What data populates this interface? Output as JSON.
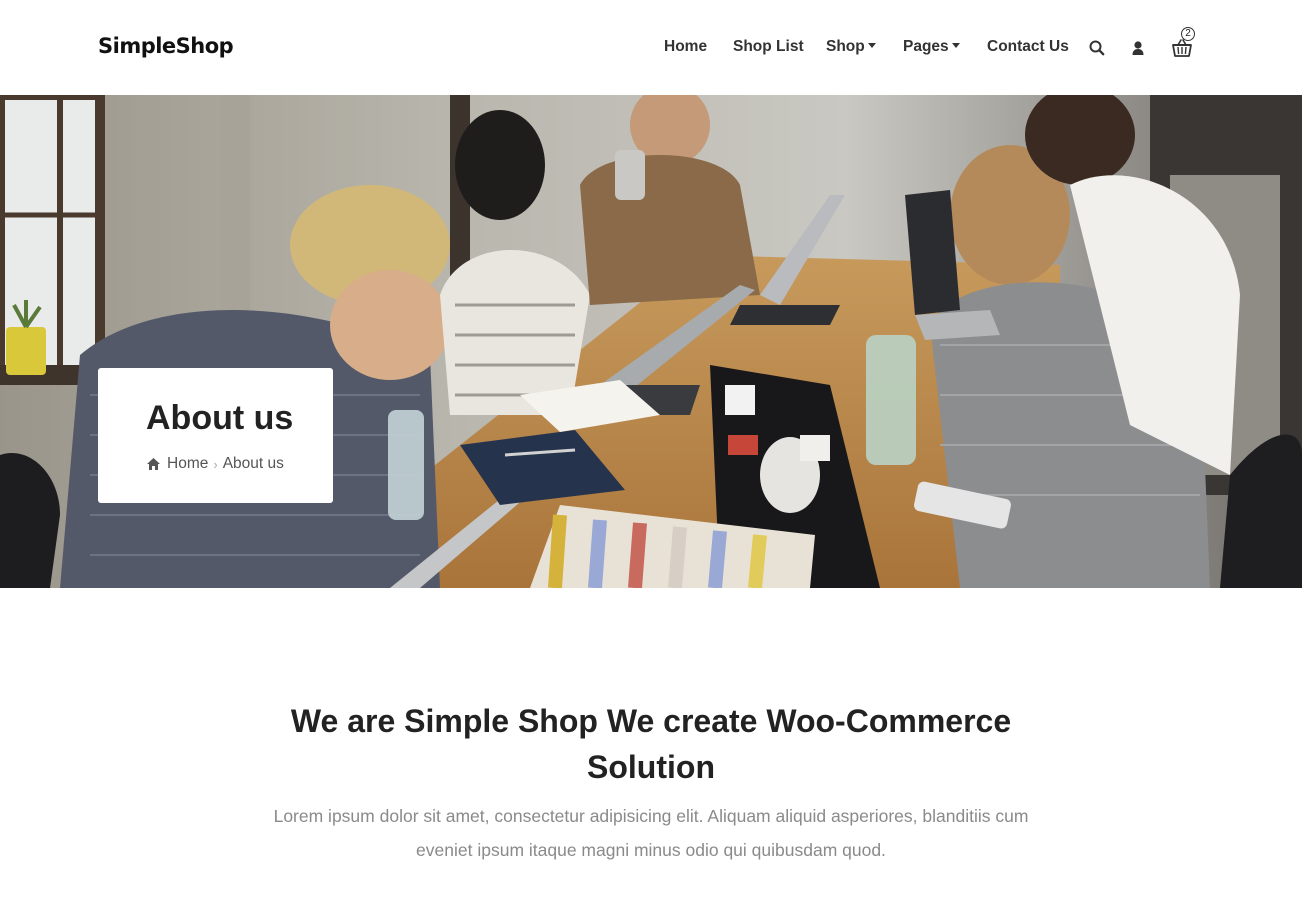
{
  "header": {
    "logo": "SimpleShop",
    "nav": [
      {
        "label": "Home"
      },
      {
        "label": "Shop List"
      },
      {
        "label": "Shop"
      },
      {
        "label": "Pages"
      },
      {
        "label": "Contact Us"
      }
    ],
    "icons": [
      "search-icon",
      "user-icon",
      "cart-icon"
    ],
    "cart_count": "2"
  },
  "hero": {
    "image": "team-working-at-laptops-photo",
    "title": "About us",
    "breadcrumb": {
      "home": "Home",
      "current": "About us"
    }
  },
  "intro": {
    "headline": "We are Simple Shop We create Woo-Commerce Solution",
    "text": "Lorem ipsum dolor sit amet, consectetur adipisicing elit. Aliquam aliquid asperiores, blanditiis cum eveniet ipsum itaque magni minus odio qui quibusdam quod."
  },
  "colors": {
    "text_dark": "#222222",
    "text_muted": "#8a8a8a",
    "background": "#ffffff"
  }
}
